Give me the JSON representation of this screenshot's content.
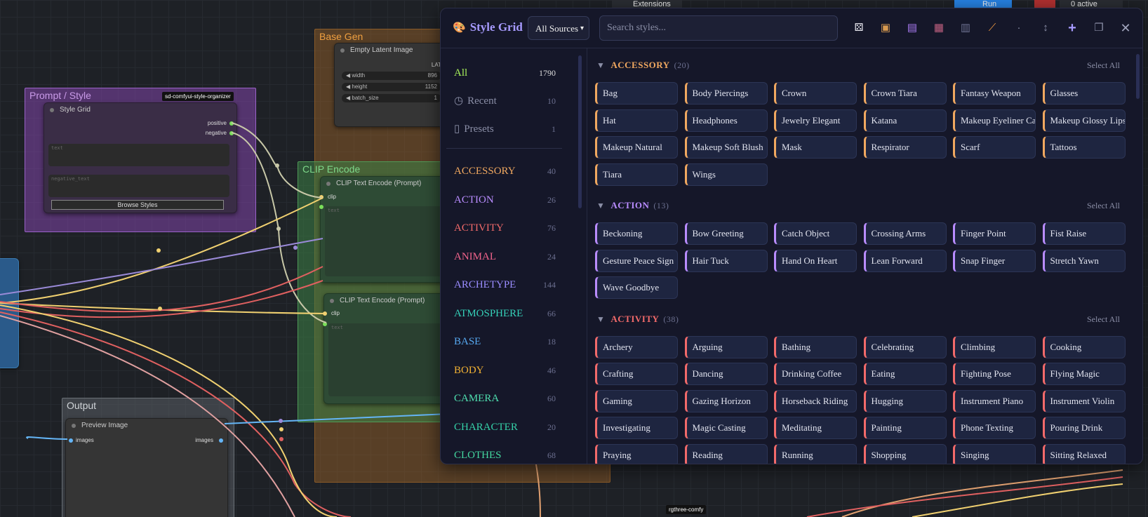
{
  "topbar": {
    "extensions_label": "Extensions",
    "run_label": "Run",
    "active_label": "0 active"
  },
  "canvas": {
    "groups": {
      "base_gen": "Base Gen",
      "prompt_style": "Prompt / Style",
      "clip_encode": "CLIP Encode",
      "output": "Output"
    },
    "badges": {
      "organizer": "sd-comfyui-style-organizer",
      "rgthree": "rgthree-comfy"
    },
    "nodes": {
      "empty_latent": {
        "title": "Empty Latent Image",
        "output_label": "LAT",
        "widgets": [
          {
            "name": "width",
            "value": "896"
          },
          {
            "name": "height",
            "value": "1152"
          },
          {
            "name": "batch_size",
            "value": "1"
          }
        ]
      },
      "style_grid": {
        "title": "Style Grid",
        "positive": "positive",
        "negative": "negative",
        "text_placeholder": "text",
        "negative_text_placeholder": "negative_text",
        "browse_button": "Browse Styles"
      },
      "clip1": {
        "title": "CLIP Text Encode (Prompt)",
        "clip": "clip",
        "text_placeholder": "text"
      },
      "clip2": {
        "title": "CLIP Text Encode (Prompt)",
        "clip": "clip",
        "text_placeholder": "text"
      },
      "preview": {
        "title": "Preview Image",
        "in": "images",
        "out": "images"
      }
    }
  },
  "panel": {
    "title": "Style Grid",
    "source_select": "All Sources",
    "search_placeholder": "Search styles...",
    "tools": [
      "dice-icon",
      "package-icon",
      "save-icon",
      "clipboard-icon",
      "document-icon",
      "brush-icon",
      "dot-icon",
      "resize-vertical-icon",
      "plus-icon",
      "window-icon",
      "close-icon"
    ],
    "sidebar": {
      "top": [
        {
          "label": "All",
          "count": "1790",
          "color": "#a7f05a"
        },
        {
          "label": "Recent",
          "count": "10",
          "color": "#8a8ea6"
        },
        {
          "label": "Presets",
          "count": "1",
          "color": "#8a8ea6"
        }
      ],
      "categories": [
        {
          "label": "ACCESSORY",
          "count": "40",
          "color": "#f0a860"
        },
        {
          "label": "ACTION",
          "count": "26",
          "color": "#b98cff"
        },
        {
          "label": "ACTIVITY",
          "count": "76",
          "color": "#f26a6a"
        },
        {
          "label": "ANIMAL",
          "count": "24",
          "color": "#f2648c"
        },
        {
          "label": "ARCHETYPE",
          "count": "144",
          "color": "#9a8cff"
        },
        {
          "label": "ATMOSPHERE",
          "count": "66",
          "color": "#35d0b8"
        },
        {
          "label": "BASE",
          "count": "18",
          "color": "#56a8f0"
        },
        {
          "label": "BODY",
          "count": "46",
          "color": "#f2b233"
        },
        {
          "label": "CAMERA",
          "count": "60",
          "color": "#4fe0b0"
        },
        {
          "label": "CHARACTER",
          "count": "20",
          "color": "#35d0a8"
        },
        {
          "label": "CLOTHES",
          "count": "68",
          "color": "#44d8a0"
        }
      ]
    },
    "sections": [
      {
        "name": "ACCESSORY",
        "count": "(20)",
        "color": "#f0a860",
        "select_all": "Select All",
        "items": [
          "Bag",
          "Body Piercings",
          "Crown",
          "Crown Tiara",
          "Fantasy Weapon",
          "Glasses",
          "Hat",
          "Headphones",
          "Jewelry Elegant",
          "Katana",
          "Makeup Eyeliner Cat",
          "Makeup Glossy Lips",
          "Makeup Natural",
          "Makeup Soft Blush",
          "Mask",
          "Respirator",
          "Scarf",
          "Tattoos",
          "Tiara",
          "Wings"
        ]
      },
      {
        "name": "ACTION",
        "count": "(13)",
        "color": "#b98cff",
        "select_all": "Select All",
        "items": [
          "Beckoning",
          "Bow Greeting",
          "Catch Object",
          "Crossing Arms",
          "Finger Point",
          "Fist Raise",
          "Gesture Peace Sign",
          "Hair Tuck",
          "Hand On Heart",
          "Lean Forward",
          "Snap Finger",
          "Stretch Yawn",
          "Wave Goodbye"
        ]
      },
      {
        "name": "ACTIVITY",
        "count": "(38)",
        "color": "#f26a6a",
        "select_all": "Select All",
        "items": [
          "Archery",
          "Arguing",
          "Bathing",
          "Celebrating",
          "Climbing",
          "Cooking",
          "Crafting",
          "Dancing",
          "Drinking Coffee",
          "Eating",
          "Fighting Pose",
          "Flying Magic",
          "Gaming",
          "Gazing Horizon",
          "Horseback Riding",
          "Hugging",
          "Instrument Piano",
          "Instrument Violin",
          "Investigating",
          "Magic Casting",
          "Meditating",
          "Painting",
          "Phone Texting",
          "Pouring Drink",
          "Praying",
          "Reading",
          "Running",
          "Shopping",
          "Singing",
          "Sitting Relaxed"
        ]
      }
    ]
  }
}
